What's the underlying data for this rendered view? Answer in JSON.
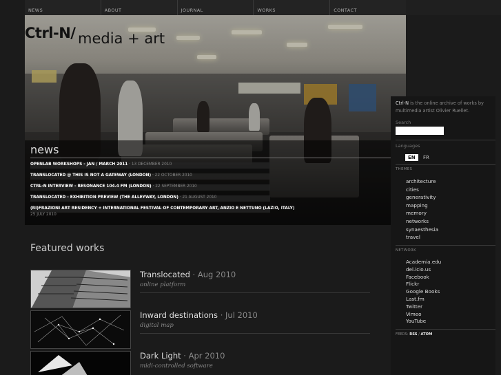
{
  "nav": {
    "items": [
      {
        "label": "NEWS"
      },
      {
        "label": "ABOUT"
      },
      {
        "label": "JOURNAL"
      },
      {
        "label": "WORKS"
      },
      {
        "label": "CONTACT"
      }
    ]
  },
  "site": {
    "logo": "Ctrl-N/",
    "tagline": "media + art"
  },
  "news": {
    "title": "news",
    "items": [
      {
        "title": "OPENLAB WORKSHOPS - JAN / MARCH 2011",
        "date": "13 DECEMBER 2010"
      },
      {
        "title": "TRANSLOCATED @ THIS IS NOT A GATEWAY (LONDON)",
        "date": "22 OCTOBER 2010"
      },
      {
        "title": "CTRL-N INTERVIEW - RESONANCE 104.4 FM (LONDON)",
        "date": "22 SEPTEMBER 2010"
      },
      {
        "title": "TRANSLOCATED - EXHIBITION PREVIEW (THE ALLEYWAY, LONDON)",
        "date": "21 AUGUST 2010"
      },
      {
        "title": "(RI)FRAZIONI ART RESIDENCY + INTERNATIONAL FESTIVAL OF CONTEMPORARY ART, ANZIO E NETTUNO (LAZIO, ITALY)",
        "date": "25 JULY 2010"
      }
    ]
  },
  "featured": {
    "title": "Featured works",
    "works": [
      {
        "title": "Translocated",
        "date": "Aug 2010",
        "subtitle": "online platform"
      },
      {
        "title": "Inward destinations",
        "date": "Jul 2010",
        "subtitle": "digital map"
      },
      {
        "title": "Dark Light",
        "date": "Apr 2010",
        "subtitle": "midi-controlled software"
      }
    ]
  },
  "sidebar": {
    "intro_brand": "Ctrl-N",
    "intro_text": " is the online archive of works by multimedia artist Olivier Ruellet.",
    "search_label": "Search",
    "languages_label": "Languages",
    "languages": [
      {
        "code": "EN",
        "active": true
      },
      {
        "code": "FR",
        "active": false
      }
    ],
    "themes_label": "THEMES",
    "themes": [
      "architecture",
      "cities",
      "generativity",
      "mapping",
      "memory",
      "networks",
      "synaesthesia",
      "travel"
    ],
    "network_label": "NETWORK",
    "network": [
      "Academia.edu",
      "del.icio.us",
      "Facebook",
      "Flickr",
      "Google Books",
      "Last.fm",
      "Twitter",
      "Vimeo",
      "YouTube"
    ],
    "feeds_label": "FEEDS:",
    "feeds": [
      "RSS",
      "ATOM"
    ],
    "feeds_sep": "/"
  }
}
